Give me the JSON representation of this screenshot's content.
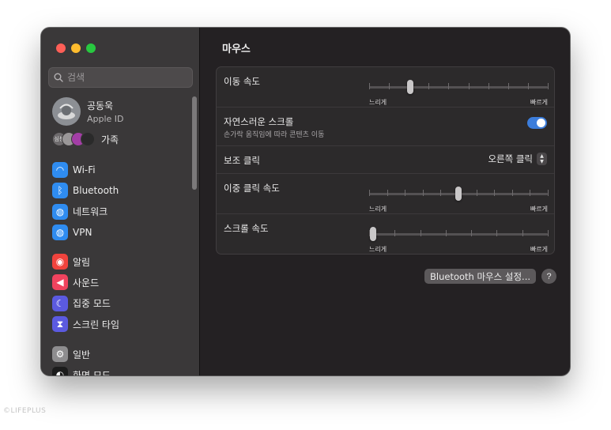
{
  "window": {
    "title": "마우스"
  },
  "sidebar": {
    "search_placeholder": "검색",
    "account": {
      "name": "공동욱",
      "subtitle": "Apple ID"
    },
    "family": {
      "label": "가족",
      "avatar1": "심봉"
    },
    "groups": [
      [
        {
          "label": "Wi-Fi",
          "icon": "wifi-icon",
          "color": "#2f8cf0",
          "glyph": "◠"
        },
        {
          "label": "Bluetooth",
          "icon": "bluetooth-icon",
          "color": "#2f8cf0",
          "glyph": "ᛒ"
        },
        {
          "label": "네트워크",
          "icon": "globe-icon",
          "color": "#2f8cf0",
          "glyph": "◍"
        },
        {
          "label": "VPN",
          "icon": "vpn-globe-icon",
          "color": "#2f8cf0",
          "glyph": "◍"
        }
      ],
      [
        {
          "label": "알림",
          "icon": "notification-bell-icon",
          "color": "#f0433d",
          "glyph": "◉"
        },
        {
          "label": "사운드",
          "icon": "speaker-icon",
          "color": "#f0435e",
          "glyph": "◀"
        },
        {
          "label": "집중 모드",
          "icon": "moon-icon",
          "color": "#5b5ae0",
          "glyph": "☾"
        },
        {
          "label": "스크린 타임",
          "icon": "hourglass-icon",
          "color": "#5b5ae0",
          "glyph": "⧗"
        }
      ],
      [
        {
          "label": "일반",
          "icon": "gear-icon",
          "color": "#8e8d8f",
          "glyph": "⚙"
        },
        {
          "label": "화면 모드",
          "icon": "appearance-icon",
          "color": "#1c1c1c",
          "glyph": "◐"
        }
      ]
    ]
  },
  "main": {
    "rows": [
      {
        "label": "이동 속도",
        "kind": "slider",
        "ticks": 10,
        "value": 0.23,
        "min_label": "느리게",
        "max_label": "빠르게"
      },
      {
        "label": "자연스러운 스크롤",
        "sub": "손가락 움직임에 따라 콘텐츠 이동",
        "kind": "toggle",
        "on": true
      },
      {
        "label": "보조 클릭",
        "kind": "popup",
        "value": "오른쪽 클릭"
      },
      {
        "label": "이중 클릭 속도",
        "kind": "slider",
        "ticks": 11,
        "value": 0.5,
        "min_label": "느리게",
        "max_label": "빠르게"
      },
      {
        "label": "스크롤 속도",
        "kind": "slider",
        "ticks": 8,
        "value": 0.0,
        "min_label": "느리게",
        "max_label": "빠르게"
      }
    ],
    "bluetooth_button": "Bluetooth 마우스 설정...",
    "help_button": "?"
  },
  "watermark": "©LIFEPLUS"
}
